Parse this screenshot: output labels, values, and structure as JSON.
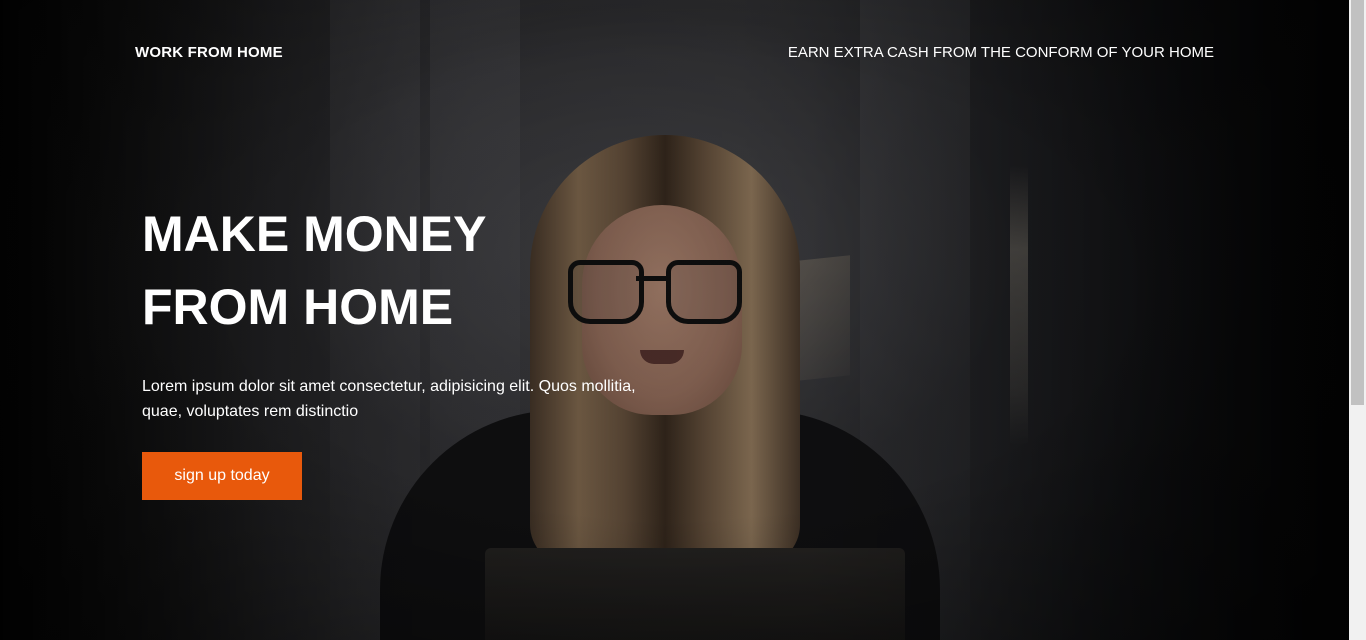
{
  "navbar": {
    "brand": "WORK FROM HOME",
    "tagline": "EARN EXTRA CASH FROM THE CONFORM OF YOUR HOME"
  },
  "hero": {
    "title_lines": [
      "MAKE MONEY",
      "FROM HOME"
    ],
    "description": "Lorem ipsum dolor sit amet consectetur, adipisicing elit. Quos mollitia, quae, voluptates rem distinctio",
    "cta_label": "sign up today",
    "background_image": "woman-with-glasses-at-laptop"
  },
  "colors": {
    "accent": "#e8590c",
    "text": "#ffffff"
  }
}
